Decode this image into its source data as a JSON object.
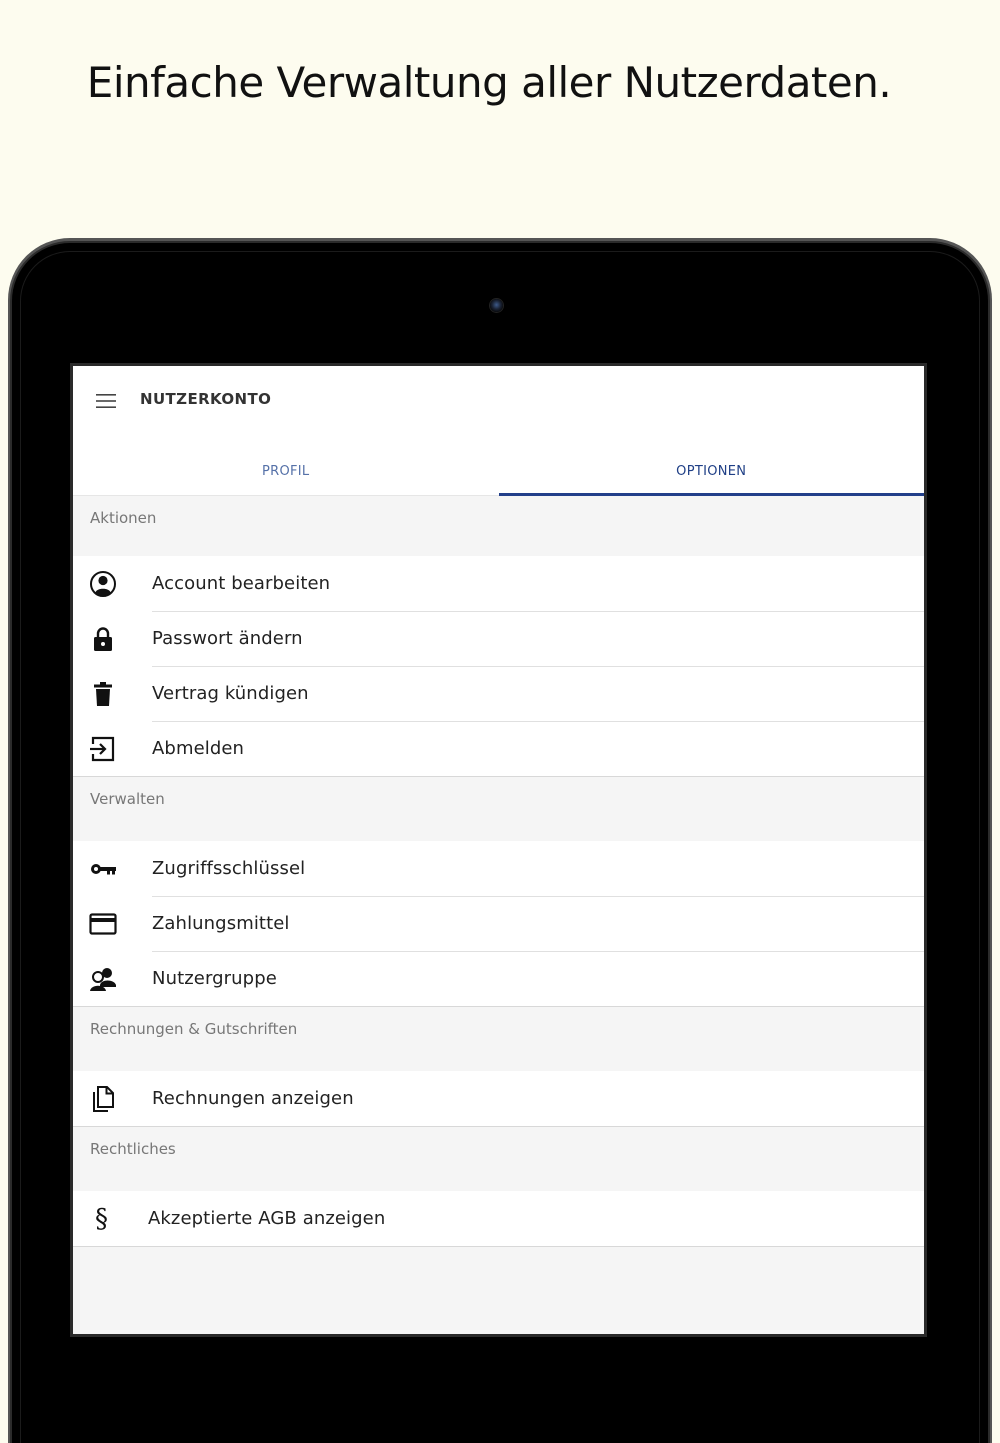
{
  "headline": "Einfache Verwaltung aller Nutzerdaten.",
  "app": {
    "title": "NUTZERKONTO",
    "menu_icon": "menu-icon"
  },
  "tabs": [
    {
      "label": "PROFIL",
      "active": false
    },
    {
      "label": "OPTIONEN",
      "active": true
    }
  ],
  "sections": {
    "aktionen": {
      "header": "Aktionen",
      "items": [
        {
          "label": "Account bearbeiten",
          "icon": "account-icon"
        },
        {
          "label": "Passwort ändern",
          "icon": "lock-icon"
        },
        {
          "label": "Vertrag kündigen",
          "icon": "trash-icon"
        },
        {
          "label": "Abmelden",
          "icon": "logout-icon"
        }
      ]
    },
    "verwalten": {
      "header": "Verwalten",
      "items": [
        {
          "label": "Zugriffsschlüssel",
          "icon": "key-icon"
        },
        {
          "label": "Zahlungsmittel",
          "icon": "credit-card-icon"
        },
        {
          "label": "Nutzergruppe",
          "icon": "user-group-icon"
        }
      ]
    },
    "rechnungen": {
      "header": "Rechnungen & Gutschriften",
      "items": [
        {
          "label": "Rechnungen anzeigen",
          "icon": "documents-icon"
        }
      ]
    },
    "rechtliches": {
      "header": "Rechtliches",
      "items": [
        {
          "label": "Akzeptierte AGB anzeigen",
          "icon": "paragraph-icon",
          "glyph": "§"
        }
      ]
    }
  },
  "colors": {
    "background": "#fdfcef",
    "accent": "#223f8a",
    "tab_inactive": "#5571a8"
  }
}
